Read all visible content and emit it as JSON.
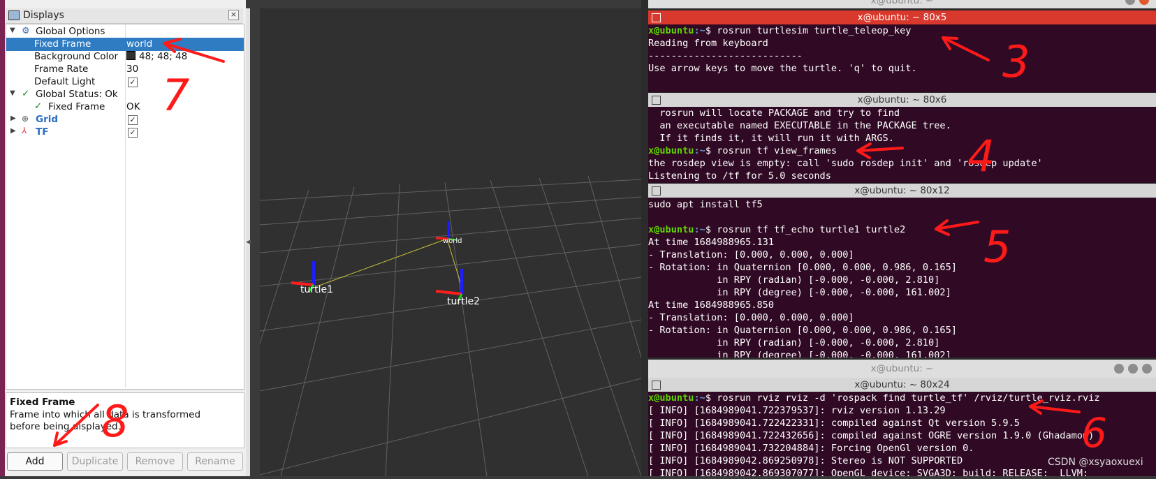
{
  "rviz": {
    "panel_title": "Displays",
    "tree": [
      {
        "label": "Global Options",
        "value": ""
      },
      {
        "label": "Fixed Frame",
        "value": "world"
      },
      {
        "label": "Background Color",
        "value": "48; 48; 48"
      },
      {
        "label": "Frame Rate",
        "value": "30"
      },
      {
        "label": "Default Light",
        "value": "✓"
      },
      {
        "label": "Global Status: Ok",
        "value": ""
      },
      {
        "label": "Fixed Frame",
        "value": "OK"
      },
      {
        "label": "Grid",
        "value": "✓"
      },
      {
        "label": "TF",
        "value": "✓"
      }
    ],
    "help": {
      "title": "Fixed Frame",
      "description": "Frame into which all data is transformed before being displayed."
    },
    "buttons": [
      "Add",
      "Duplicate",
      "Remove",
      "Rename"
    ]
  },
  "view3d": {
    "frames": [
      "world",
      "turtle1",
      "turtle2"
    ],
    "axis_colors": {
      "x": "#ff1e1e",
      "y": "#1fd11f",
      "z": "#1d1dff"
    },
    "background": "#303030"
  },
  "terminals": {
    "window_top_title": "x@ubuntu: ~",
    "t1": {
      "title": "x@ubuntu: ~ 80x5",
      "prompt_user": "x@ubuntu",
      "prompt_path": ":~",
      "cmd": "$ rosrun turtlesim turtle_teleop_key",
      "lines": [
        "Reading from keyboard",
        "---------------------------",
        "Use arrow keys to move the turtle. 'q' to quit."
      ]
    },
    "t2": {
      "title": "x@ubuntu: ~ 80x6",
      "lines_before": [
        "  rosrun will locate PACKAGE and try to find",
        "  an executable named EXECUTABLE in the PACKAGE tree.",
        "  If it finds it, it will run it with ARGS."
      ],
      "prompt_user": "x@ubuntu",
      "prompt_path": ":~",
      "cmd": "$ rosrun tf view_frames",
      "lines_after": [
        "the rosdep view is empty: call 'sudo rosdep init' and 'rosdep update'",
        "Listening to /tf for 5.0 seconds"
      ]
    },
    "t3": {
      "title": "x@ubuntu: ~ 80x12",
      "line0": "sudo apt install tf5",
      "prompt_user": "x@ubuntu",
      "prompt_path": ":~",
      "cmd": "$ rosrun tf tf_echo turtle1 turtle2",
      "lines": [
        "At time 1684988965.131",
        "- Translation: [0.000, 0.000, 0.000]",
        "- Rotation: in Quaternion [0.000, 0.000, 0.986, 0.165]",
        "            in RPY (radian) [-0.000, -0.000, 2.810]",
        "            in RPY (degree) [-0.000, -0.000, 161.002]",
        "At time 1684988965.850",
        "- Translation: [0.000, 0.000, 0.000]",
        "- Rotation: in Quaternion [0.000, 0.000, 0.986, 0.165]",
        "            in RPY (radian) [-0.000, -0.000, 2.810]",
        "            in RPY (degree) [-0.000, -0.000, 161.002]"
      ]
    },
    "window2_title": "x@ubuntu: ~",
    "t4": {
      "title": "x@ubuntu: ~ 80x24",
      "prompt_user": "x@ubuntu",
      "prompt_path": ":~",
      "cmd": "$ rosrun rviz rviz -d 'rospack find turtle_tf' /rviz/turtle_rviz.rviz",
      "lines": [
        "[ INFO] [1684989041.722379537]: rviz version 1.13.29",
        "[ INFO] [1684989041.722422331]: compiled against Qt version 5.9.5",
        "[ INFO] [1684989041.722432656]: compiled against OGRE version 1.9.0 (Ghadamon)",
        "[ INFO] [1684989041.732204884]: Forcing OpenGl version 0.",
        "[ INFO] [1684989042.869250978]: Stereo is NOT SUPPORTED",
        "[ INFO] [1684989042.869307077]: OpenGL device: SVGA3D; build: RELEASE;  LLVM;"
      ]
    }
  },
  "annotations": [
    "7",
    "3",
    "4",
    "5",
    "6",
    "8"
  ],
  "watermark": "CSDN @xsyaoxuexi"
}
